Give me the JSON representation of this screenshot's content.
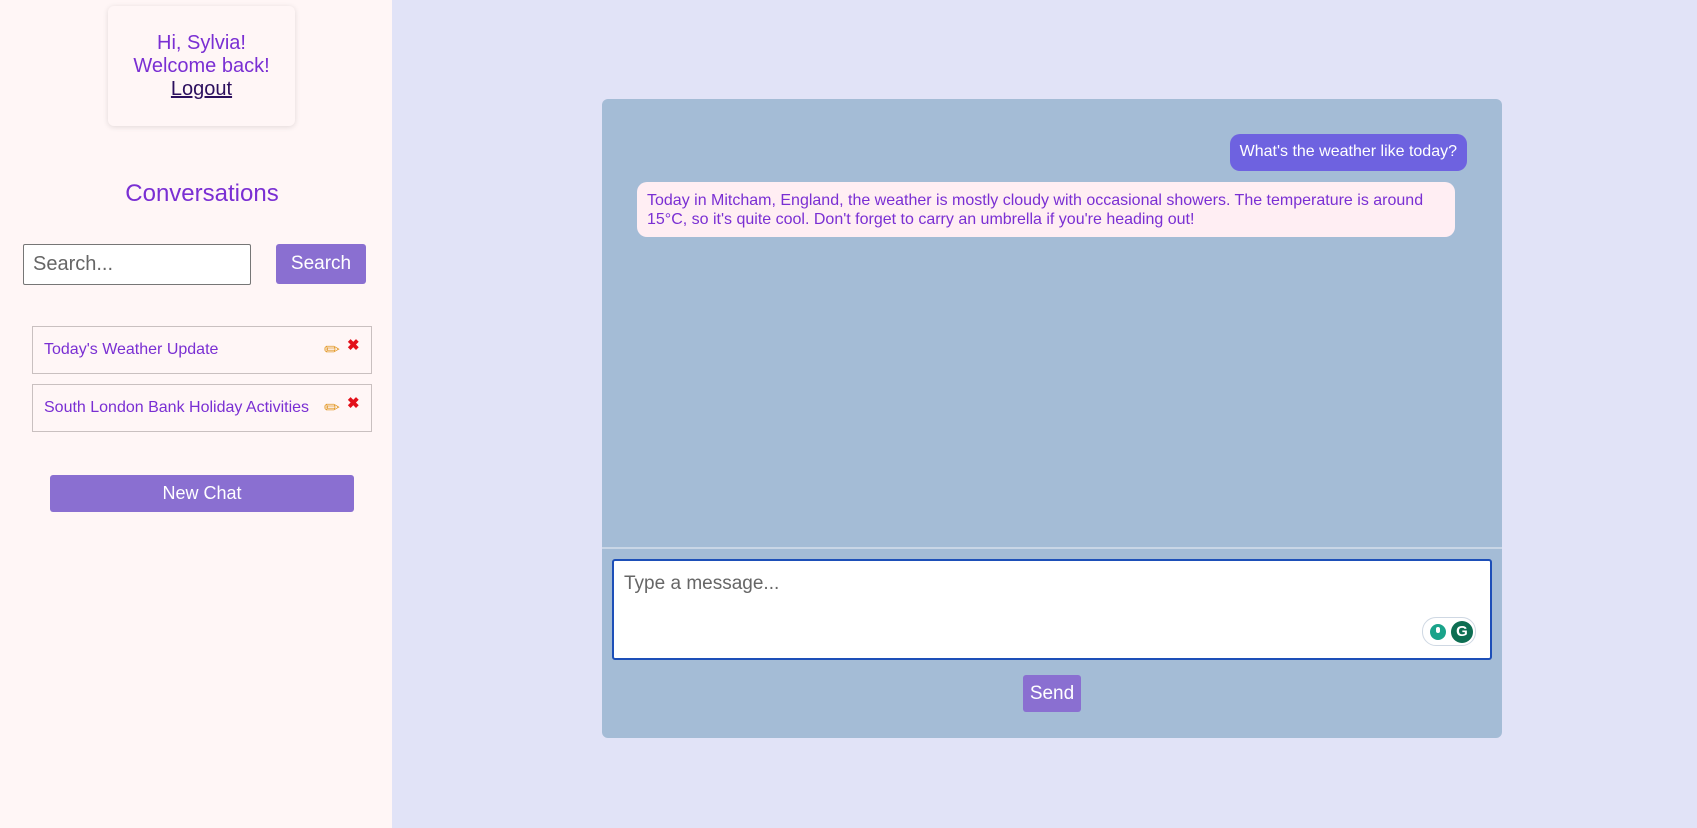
{
  "user": {
    "greeting": "Hi, Sylvia!",
    "welcome": "Welcome back!",
    "logout_label": "Logout"
  },
  "sidebar": {
    "title": "Conversations",
    "search_placeholder": "Search...",
    "search_label": "Search",
    "conversations": [
      {
        "label": "Today's Weather Update",
        "edit_icon": "pencil-icon",
        "delete_icon": "close-icon"
      },
      {
        "label": "South London Bank Holiday Activities",
        "edit_icon": "pencil-icon",
        "delete_icon": "close-icon"
      }
    ],
    "new_chat_label": "New Chat"
  },
  "chat": {
    "messages": [
      {
        "role": "user",
        "text": "What's the weather like today?"
      },
      {
        "role": "assistant",
        "text": "Today in Mitcham, England, the weather is mostly cloudy with occasional showers. The temperature is around 15°C, so it's quite cool. Don't forget to carry an umbrella if you're heading out!"
      }
    ],
    "input_placeholder": "Type a message...",
    "send_label": "Send"
  },
  "colors": {
    "accent": "#8a6fd1",
    "text_purple": "#7a2fd3",
    "user_bubble": "#6e62e0",
    "chat_panel": "#a4bcd6"
  }
}
